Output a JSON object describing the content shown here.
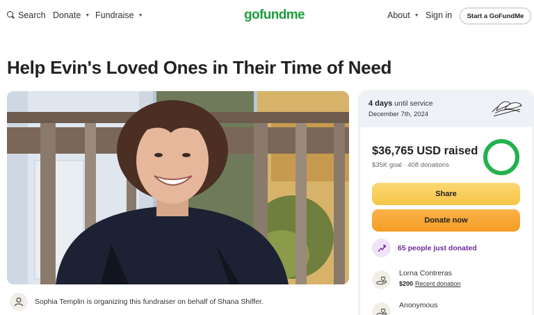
{
  "nav": {
    "search_label": "Search",
    "donate_label": "Donate",
    "fundraise_label": "Fundraise",
    "logo_text": "gofundme",
    "about_label": "About",
    "signin_label": "Sign in",
    "start_label": "Start a GoFundMe",
    "brand_color": "#1c9e3a"
  },
  "campaign": {
    "title": "Help Evin's Loved Ones in Their Time of Need"
  },
  "organizer": {
    "text": "Sophia Templin is organizing this fundraiser on behalf of Shana Shiffer."
  },
  "sidebar": {
    "banner_days": "4 days",
    "banner_until": "until service",
    "banner_date": "December 7th, 2024",
    "raised_amount": "$36,765",
    "raised_unit": "USD raised",
    "goal": "$35K goal",
    "goal_sep": "·",
    "donations": "408 donations",
    "progress_fraction": 1.0,
    "share_label": "Share",
    "donate_now_label": "Donate now",
    "trend_text": "65 people just donated",
    "donors": [
      {
        "name": "Lorna Contreras",
        "amount": "$200",
        "note": "Recent donation"
      },
      {
        "name": "Anonymous",
        "amount": "",
        "note": ""
      }
    ],
    "colors": {
      "share": "#f6c547",
      "donate": "#f59c24",
      "trend": "#6c2b9c",
      "ring": "#22b24c"
    }
  }
}
